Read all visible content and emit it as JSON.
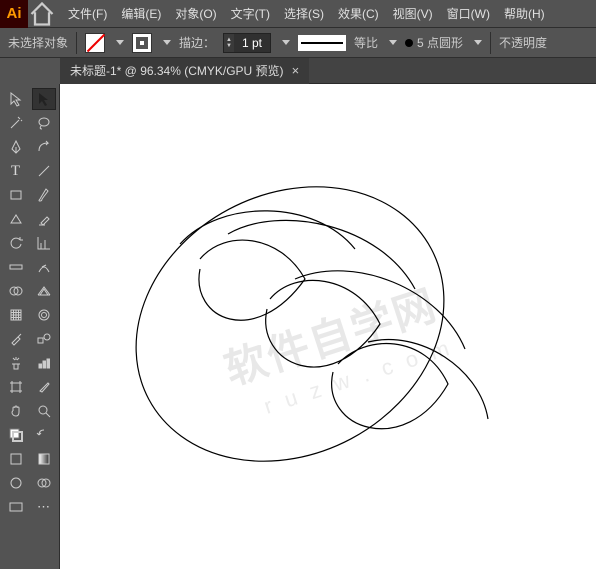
{
  "menu": {
    "file": "文件(F)",
    "edit": "编辑(E)",
    "object": "对象(O)",
    "text": "文字(T)",
    "select": "选择(S)",
    "effect": "效果(C)",
    "view": "视图(V)",
    "window": "窗口(W)",
    "help": "帮助(H)"
  },
  "ctrl": {
    "no_selection": "未选择对象",
    "stroke_label": "描边：",
    "stroke_value": "1 pt",
    "scaling_label": "等比",
    "profile_label": "5 点圆形",
    "opacity_label": "不透明度"
  },
  "tab": {
    "title": "未标题-1* @ 96.34% (CMYK/GPU 预览)",
    "close": "×"
  },
  "logo": "Ai",
  "watermark": {
    "main": "软件自学网",
    "sub": "r u z w . c o m"
  }
}
